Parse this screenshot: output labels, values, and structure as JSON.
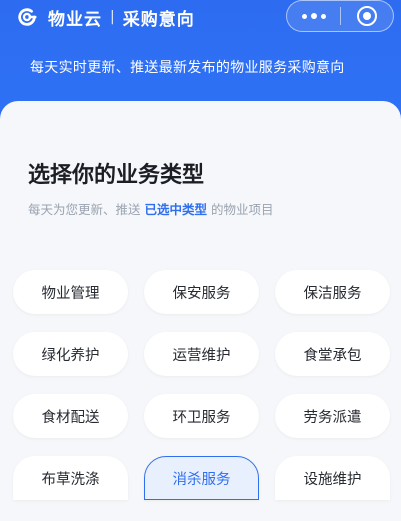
{
  "header": {
    "app_name": "物业云",
    "separator": "|",
    "section": "采购意向",
    "description": "每天实时更新、推送最新发布的物业服务采购意向",
    "background_color": "#2f6ff2",
    "logo_icon": "cloud-logo-icon",
    "more_icon": "more-dots-icon",
    "close_icon": "target-close-icon"
  },
  "main": {
    "title": "选择你的业务类型",
    "subtitle_prefix": "每天为您更新、推送",
    "subtitle_highlight": "已选中类型",
    "subtitle_suffix": "的物业项目",
    "accent_color": "#2f6fef"
  },
  "business_types": [
    {
      "label": "物业管理",
      "selected": false
    },
    {
      "label": "保安服务",
      "selected": false
    },
    {
      "label": "保洁服务",
      "selected": false
    },
    {
      "label": "绿化养护",
      "selected": false
    },
    {
      "label": "运营维护",
      "selected": false
    },
    {
      "label": "食堂承包",
      "selected": false
    },
    {
      "label": "食材配送",
      "selected": false
    },
    {
      "label": "环卫服务",
      "selected": false
    },
    {
      "label": "劳务派遣",
      "selected": false
    },
    {
      "label": "布草洗涤",
      "selected": false
    },
    {
      "label": "消杀服务",
      "selected": true
    },
    {
      "label": "设施维护",
      "selected": false
    }
  ]
}
